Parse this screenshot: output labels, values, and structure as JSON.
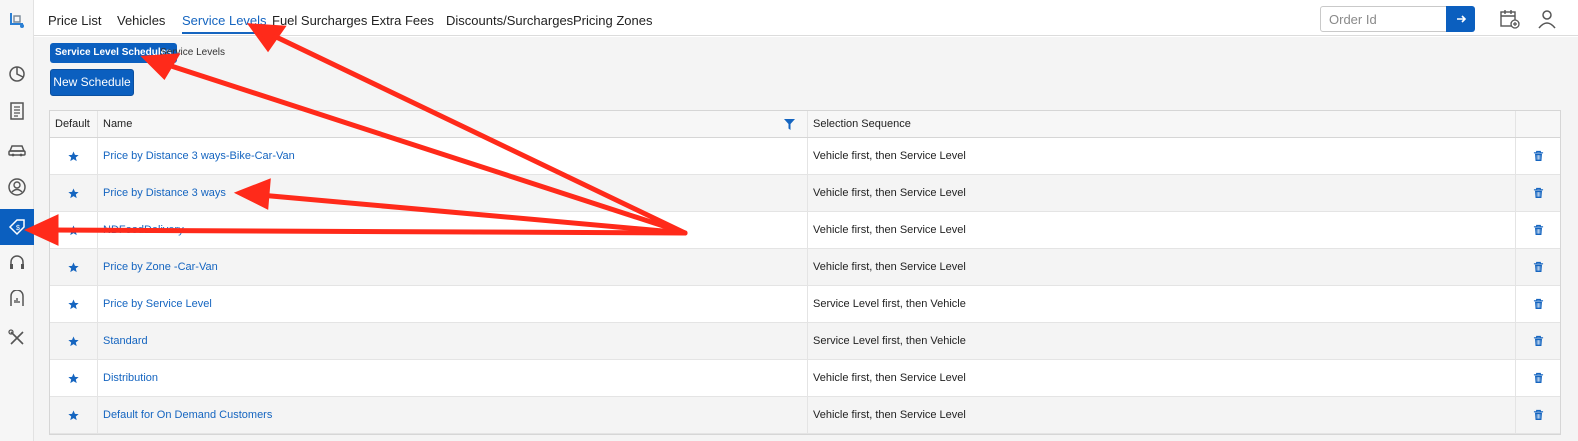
{
  "nav": {
    "tabs": [
      {
        "label": "Price List",
        "active": false
      },
      {
        "label": "Vehicles",
        "active": false
      },
      {
        "label": "Service Levels",
        "active": true
      },
      {
        "label": "Fuel Surcharges",
        "active": false
      },
      {
        "label": "Extra Fees",
        "active": false
      },
      {
        "label": "Discounts/Surcharges",
        "active": false
      },
      {
        "label": "Pricing Zones",
        "active": false
      }
    ],
    "order_search": {
      "placeholder": "Order Id",
      "value": ""
    }
  },
  "sidebar": {
    "items": [
      {
        "icon": "app-logo-icon",
        "active": false
      },
      {
        "icon": "dashboard-chart-icon",
        "active": false
      },
      {
        "icon": "orders-list-icon",
        "active": false
      },
      {
        "icon": "car-icon",
        "active": false
      },
      {
        "icon": "user-circle-icon",
        "active": false
      },
      {
        "icon": "price-tag-icon",
        "active": true
      },
      {
        "icon": "headset-icon",
        "active": false
      },
      {
        "icon": "reports-icon",
        "active": false
      },
      {
        "icon": "tools-icon",
        "active": false
      }
    ]
  },
  "subtabs": [
    {
      "label": "Service Level Schedules",
      "active": true
    },
    {
      "label": "Service Levels",
      "active": false
    }
  ],
  "new_schedule_label": "New Schedule",
  "table": {
    "columns": [
      "Default",
      "Name",
      "Selection Sequence",
      ""
    ],
    "rows": [
      {
        "name": "Price by Distance 3 ways-Bike-Car-Van",
        "sequence": "Vehicle first, then Service Level"
      },
      {
        "name": "Price by Distance 3 ways",
        "sequence": "Vehicle first, then Service Level"
      },
      {
        "name": "NDFoodDelivery",
        "sequence": "Vehicle first, then Service Level"
      },
      {
        "name": "Price by Zone -Car-Van",
        "sequence": "Vehicle first, then Service Level"
      },
      {
        "name": "Price by Service Level",
        "sequence": "Service Level first, then Vehicle"
      },
      {
        "name": "Standard",
        "sequence": "Service Level first, then Vehicle"
      },
      {
        "name": "Distribution",
        "sequence": "Vehicle first, then Service Level"
      },
      {
        "name": "Default for On Demand Customers",
        "sequence": "Vehicle first, then Service Level"
      }
    ]
  },
  "colors": {
    "accent": "#0b5fbf",
    "link": "#1565c0",
    "annotation_arrow": "#ff2a1a"
  }
}
